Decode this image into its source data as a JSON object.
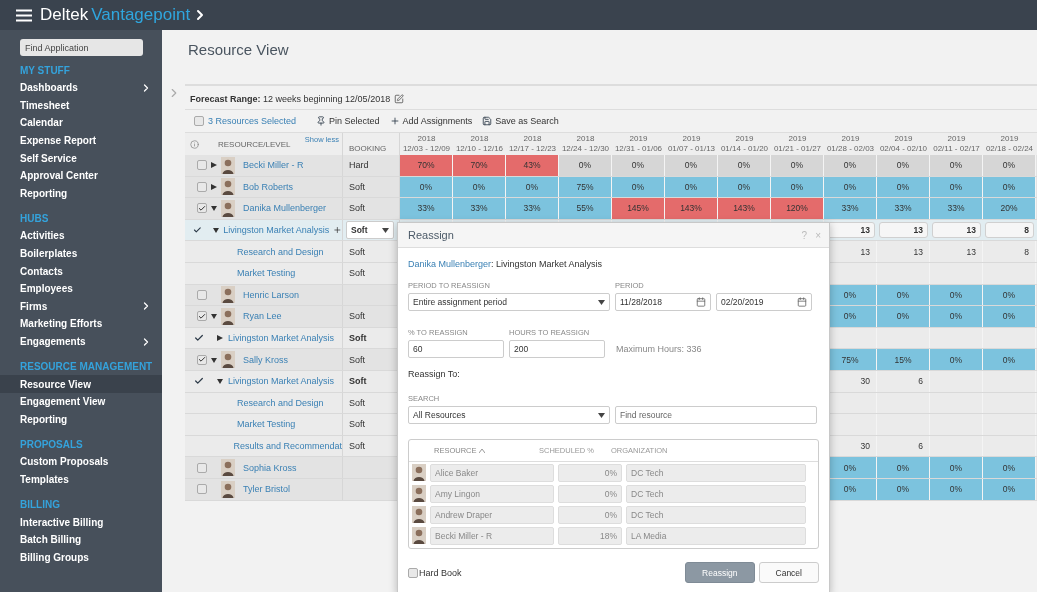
{
  "app": {
    "brand": "Deltek",
    "product": "Vantagepoint"
  },
  "sidebar": {
    "search_placeholder": "Find Application",
    "sections": [
      {
        "title": "MY STUFF",
        "items": [
          {
            "label": "Dashboards",
            "has_submenu": true,
            "selected": false
          },
          {
            "label": "Timesheet",
            "has_submenu": false,
            "selected": false
          },
          {
            "label": "Calendar",
            "has_submenu": false,
            "selected": false
          },
          {
            "label": "Expense Report",
            "has_submenu": false,
            "selected": false
          },
          {
            "label": "Self Service",
            "has_submenu": false,
            "selected": false
          },
          {
            "label": "Approval Center",
            "has_submenu": false,
            "selected": false
          },
          {
            "label": "Reporting",
            "has_submenu": false,
            "selected": false
          }
        ]
      },
      {
        "title": "HUBS",
        "items": [
          {
            "label": "Activities",
            "has_submenu": false,
            "selected": false
          },
          {
            "label": "Boilerplates",
            "has_submenu": false,
            "selected": false
          },
          {
            "label": "Contacts",
            "has_submenu": false,
            "selected": false
          },
          {
            "label": "Employees",
            "has_submenu": false,
            "selected": false
          },
          {
            "label": "Firms",
            "has_submenu": true,
            "selected": false
          },
          {
            "label": "Marketing Efforts",
            "has_submenu": false,
            "selected": false
          },
          {
            "label": "Engagements",
            "has_submenu": true,
            "selected": false
          }
        ]
      },
      {
        "title": "RESOURCE MANAGEMENT",
        "items": [
          {
            "label": "Resource View",
            "has_submenu": false,
            "selected": true
          },
          {
            "label": "Engagement View",
            "has_submenu": false,
            "selected": false
          },
          {
            "label": "Reporting",
            "has_submenu": false,
            "selected": false
          }
        ]
      },
      {
        "title": "PROPOSALS",
        "items": [
          {
            "label": "Custom Proposals",
            "has_submenu": false,
            "selected": false
          },
          {
            "label": "Templates",
            "has_submenu": false,
            "selected": false
          }
        ]
      },
      {
        "title": "BILLING",
        "items": [
          {
            "label": "Interactive Billing",
            "has_submenu": false,
            "selected": false
          },
          {
            "label": "Batch Billing",
            "has_submenu": false,
            "selected": false
          },
          {
            "label": "Billing Groups",
            "has_submenu": false,
            "selected": false
          }
        ]
      }
    ]
  },
  "page_title": "Resource View",
  "forecast": {
    "label": "Forecast Range:",
    "value": "12 weeks beginning 12/05/2018"
  },
  "toolbar": {
    "selection": "3 Resources Selected",
    "selection_checked": false,
    "actions": [
      {
        "label": "Pin Selected"
      },
      {
        "label": "Add Assignments"
      },
      {
        "label": "Save as Search"
      }
    ]
  },
  "grid": {
    "resource_header": "RESOURCE/LEVEL",
    "show_less": "Show less",
    "booking_header": "BOOKING",
    "weeks": [
      {
        "year": "2018",
        "range": "12/03 - 12/09"
      },
      {
        "year": "2018",
        "range": "12/10 - 12/16"
      },
      {
        "year": "2018",
        "range": "12/17 - 12/23"
      },
      {
        "year": "2018",
        "range": "12/24 - 12/30"
      },
      {
        "year": "2019",
        "range": "12/31 - 01/06"
      },
      {
        "year": "2019",
        "range": "01/07 - 01/13"
      },
      {
        "year": "2019",
        "range": "01/14 - 01/20"
      },
      {
        "year": "2019",
        "range": "01/21 - 01/27"
      },
      {
        "year": "2019",
        "range": "01/28 - 02/03"
      },
      {
        "year": "2019",
        "range": "02/04 - 02/10"
      },
      {
        "year": "2019",
        "range": "02/11 - 02/17"
      },
      {
        "year": "2019",
        "range": "02/18 - 02/24"
      }
    ],
    "rows": [
      {
        "kind": "resource",
        "name": "Becki Miller - R",
        "checked": false,
        "expanded": false,
        "booking": "Hard",
        "cells": [
          {
            "text": "70%",
            "kind": "over"
          },
          {
            "text": "70%",
            "kind": "over"
          },
          {
            "text": "43%",
            "kind": "over"
          },
          {
            "text": "0%",
            "kind": "unbooked"
          },
          {
            "text": "0%",
            "kind": "unbooked"
          },
          {
            "text": "0%",
            "kind": "unbooked"
          },
          {
            "text": "0%",
            "kind": "unbooked"
          },
          {
            "text": "0%",
            "kind": "unbooked"
          },
          {
            "text": "0%",
            "kind": "unbooked"
          },
          {
            "text": "0%",
            "kind": "unbooked"
          },
          {
            "text": "0%",
            "kind": "unbooked"
          },
          {
            "text": "0%",
            "kind": "unbooked"
          }
        ]
      },
      {
        "kind": "resource",
        "name": "Bob Roberts",
        "checked": false,
        "expanded": false,
        "booking": "Soft",
        "cells": [
          {
            "text": "0%",
            "kind": "booked"
          },
          {
            "text": "0%",
            "kind": "booked"
          },
          {
            "text": "0%",
            "kind": "booked"
          },
          {
            "text": "75%",
            "kind": "booked"
          },
          {
            "text": "0%",
            "kind": "booked"
          },
          {
            "text": "0%",
            "kind": "booked"
          },
          {
            "text": "0%",
            "kind": "booked"
          },
          {
            "text": "0%",
            "kind": "booked"
          },
          {
            "text": "0%",
            "kind": "booked"
          },
          {
            "text": "0%",
            "kind": "booked"
          },
          {
            "text": "0%",
            "kind": "booked"
          },
          {
            "text": "0%",
            "kind": "booked"
          }
        ]
      },
      {
        "kind": "resource",
        "name": "Danika Mullenberger",
        "checked": true,
        "expanded": true,
        "booking": "Soft",
        "cells": [
          {
            "text": "33%",
            "kind": "booked"
          },
          {
            "text": "33%",
            "kind": "booked"
          },
          {
            "text": "33%",
            "kind": "booked"
          },
          {
            "text": "55%",
            "kind": "booked"
          },
          {
            "text": "145%",
            "kind": "over"
          },
          {
            "text": "143%",
            "kind": "over"
          },
          {
            "text": "143%",
            "kind": "over"
          },
          {
            "text": "120%",
            "kind": "over"
          },
          {
            "text": "33%",
            "kind": "booked"
          },
          {
            "text": "33%",
            "kind": "booked"
          },
          {
            "text": "33%",
            "kind": "booked"
          },
          {
            "text": "20%",
            "kind": "booked"
          }
        ]
      },
      {
        "kind": "assignment",
        "name": "Livingston Market Analysis",
        "checked": true,
        "expanded": true,
        "selected": true,
        "booking": "Soft",
        "booking_dropdown": true,
        "cells": [
          {
            "text": "13",
            "kind": "input"
          },
          {
            "text": "13",
            "kind": "input"
          },
          {
            "text": "13",
            "kind": "input"
          },
          {
            "text": "8",
            "kind": "input"
          }
        ]
      },
      {
        "kind": "level",
        "name": "Research and Design",
        "booking": "Soft",
        "cells": [
          {
            "text": "13",
            "kind": "hours"
          },
          {
            "text": "13",
            "kind": "hours"
          },
          {
            "text": "13",
            "kind": "hours"
          },
          {
            "text": "8",
            "kind": "hours"
          }
        ]
      },
      {
        "kind": "level",
        "name": "Market Testing",
        "booking": "Soft",
        "cells": []
      },
      {
        "kind": "resource",
        "name": "Henric Larson",
        "checked": false,
        "cells": [
          {
            "text": "0%",
            "kind": "booked"
          },
          {
            "text": "0%",
            "kind": "booked"
          },
          {
            "text": "0%",
            "kind": "booked"
          },
          {
            "text": "0%",
            "kind": "booked"
          }
        ]
      },
      {
        "kind": "resource",
        "name": "Ryan Lee",
        "checked": true,
        "expanded": true,
        "booking": "Soft",
        "cells": [
          {
            "text": "0%",
            "kind": "booked"
          },
          {
            "text": "0%",
            "kind": "booked"
          },
          {
            "text": "0%",
            "kind": "booked"
          },
          {
            "text": "0%",
            "kind": "booked"
          }
        ]
      },
      {
        "kind": "assignment",
        "name": "Livingston Market Analysis",
        "checked": true,
        "expanded": false,
        "selected": false,
        "booking": "Soft",
        "booking_dropdown": false,
        "cells": []
      },
      {
        "kind": "resource",
        "name": "Sally Kross",
        "checked": true,
        "expanded": true,
        "booking": "Soft",
        "cells": [
          {
            "text": "75%",
            "kind": "booked"
          },
          {
            "text": "15%",
            "kind": "booked"
          },
          {
            "text": "0%",
            "kind": "booked"
          },
          {
            "text": "0%",
            "kind": "booked"
          }
        ]
      },
      {
        "kind": "assignment",
        "name": "Livingston Market Analysis",
        "checked": true,
        "expanded": true,
        "selected": false,
        "booking": "Soft",
        "booking_dropdown": false,
        "cells": [
          {
            "text": "30",
            "kind": "hours"
          },
          {
            "text": "6",
            "kind": "hours"
          },
          {
            "kind": "blank"
          },
          {
            "kind": "blank"
          }
        ]
      },
      {
        "kind": "level",
        "name": "Research and Design",
        "booking": "Soft",
        "cells": []
      },
      {
        "kind": "level",
        "name": "Market Testing",
        "booking": "Soft",
        "cells": []
      },
      {
        "kind": "level",
        "name": "Results and Recommendat",
        "booking": "Soft",
        "cells": [
          {
            "text": "30",
            "kind": "hours"
          },
          {
            "text": "6",
            "kind": "hours"
          },
          {
            "kind": "blank"
          },
          {
            "kind": "blank"
          }
        ]
      },
      {
        "kind": "resource",
        "name": "Sophia Kross",
        "checked": false,
        "cells": [
          {
            "text": "0%",
            "kind": "booked"
          },
          {
            "text": "0%",
            "kind": "booked"
          },
          {
            "text": "0%",
            "kind": "booked"
          },
          {
            "text": "0%",
            "kind": "booked"
          }
        ]
      },
      {
        "kind": "resource",
        "name": "Tyler Bristol",
        "checked": false,
        "cells": [
          {
            "text": "0%",
            "kind": "booked"
          },
          {
            "text": "0%",
            "kind": "booked"
          },
          {
            "text": "0%",
            "kind": "booked"
          },
          {
            "text": "0%",
            "kind": "booked"
          }
        ]
      }
    ]
  },
  "dialog": {
    "title": "Reassign",
    "help": "?",
    "close": "×",
    "subject_resource": "Danika Mullenberger",
    "subject_assignment": ": Livingston Market Analysis",
    "period_to_reassign": {
      "label": "PERIOD TO REASSIGN",
      "value": "Entire assignment period"
    },
    "period": {
      "label": "PERIOD",
      "start": "11/28/2018",
      "end": "02/20/2019"
    },
    "percent": {
      "label": "% TO REASSIGN",
      "value": "60"
    },
    "hours": {
      "label": "HOURS TO REASSIGN",
      "value": "200"
    },
    "max_hours": "Maximum Hours: 336",
    "reassign_to": "Reassign To:",
    "search": {
      "label": "SEARCH",
      "scope": "All Resources",
      "placeholder": "Find resource"
    },
    "columns": [
      {
        "label": "RESOURCE",
        "sorted": true
      },
      {
        "label": "SCHEDULED %",
        "sorted": false
      },
      {
        "label": "ORGANIZATION",
        "sorted": false
      }
    ],
    "rows": [
      {
        "name": "Alice Baker",
        "scheduled": "0%",
        "organization": "DC Tech"
      },
      {
        "name": "Amy Lingon",
        "scheduled": "0%",
        "organization": "DC Tech"
      },
      {
        "name": "Andrew Draper",
        "scheduled": "0%",
        "organization": "DC Tech"
      },
      {
        "name": "Becki Miller - R",
        "scheduled": "18%",
        "organization": "LA Media"
      }
    ],
    "hard_book": {
      "label": "Hard Book",
      "checked": false
    },
    "buttons": [
      {
        "label": "Reassign",
        "kind": "primary"
      },
      {
        "label": "Cancel",
        "kind": "secondary"
      }
    ]
  }
}
